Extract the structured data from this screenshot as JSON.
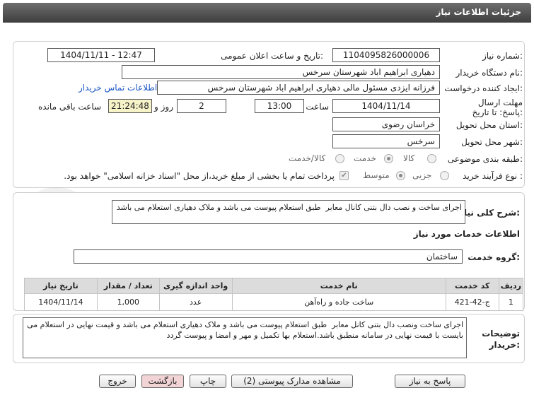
{
  "header": {
    "title": "جزئیات اطلاعات نیاز"
  },
  "need_number": {
    "label": "شماره نیاز:",
    "value": "1104095826000006"
  },
  "announce_date": {
    "label": "تاریخ و ساعت اعلان عمومی:",
    "value": "1404/11/11 - 12:47"
  },
  "buyer_org": {
    "label": "نام دستگاه خریدار:",
    "value": "دهیاری ابراهیم اباد شهرستان سرخس"
  },
  "requester": {
    "label": "ایجاد کننده درخواست:",
    "value": "فرزانه ایزدی مسئول مالی دهیاری ابراهیم اباد شهرستان سرخس",
    "contact_link": "اطلاعات تماس خریدار"
  },
  "deadline": {
    "label": "مهلت ارسال پاسخ: تا تاریخ:",
    "date": "1404/11/14",
    "time_label": "ساعت",
    "time": "13:00",
    "days": "2",
    "days_label": "روز و",
    "remaining": "21:24:48",
    "remaining_label": "ساعت باقی مانده"
  },
  "province": {
    "label": "استان محل تحویل:",
    "value": "خراسان رضوی"
  },
  "city": {
    "label": "شهر محل تحویل:",
    "value": "سرخس"
  },
  "category": {
    "label": "طبقه بندی موضوعی:",
    "options": [
      "کالا",
      "خدمت",
      "کالا/خدمت"
    ],
    "selected": "خدمت"
  },
  "process": {
    "label": "نوع فرآیند خرید :",
    "options": [
      "جزیی",
      "متوسط"
    ],
    "selected": "متوسط",
    "note": "پرداخت تمام یا بخشی از مبلغ خرید،از محل \"اسناد خزانه اسلامی\" خواهد بود."
  },
  "description": {
    "label": "شرح کلی نیاز:",
    "value": "اجرای ساخت و نصب دال بتنی کانال معابر  طبق استعلام پیوست می باشد و ملاک دهیاری استعلام می باشد"
  },
  "services_info": {
    "title": "اطلاعات خدمات مورد نیاز"
  },
  "service_group": {
    "label": "گروه خدمت:",
    "value": "ساختمان"
  },
  "table": {
    "headers": [
      "ردیف",
      "کد خدمت",
      "نام خدمت",
      "واحد اندازه گیری",
      "تعداد / مقدار",
      "تاریخ نیاز"
    ],
    "rows": [
      [
        "1",
        "ج-42-421",
        "ساخت جاده و راه‌آهن",
        "عدد",
        "1,000",
        "1404/11/14"
      ]
    ]
  },
  "buyer_notes": {
    "label": "توضیحات خریدار:",
    "value": "اجرای ساخت ونصب دال بتنی کانل معابر  طبق استعلام پیوست می باشد و ملاک دهیاری استعلام می باشد و قیمت نهایی در استعلام می بایست با قیمت نهایی در سامانه منطبق باشد.استعلام بها تکمیل و مهر و امضا و پیوست گردد"
  },
  "buttons": {
    "reply": "پاسخ به نیاز",
    "view_docs": "مشاهده مدارک پیوستی (2)",
    "print": "چاپ",
    "back": "بازگشت",
    "exit": "خروج"
  },
  "watermark": {
    "text": "AriaTender.net"
  },
  "colors": {
    "header_bg": "#4a4a4a",
    "link": "#1a57c6",
    "remaining_bg": "#f7f3c8",
    "back_btn": "#f3d4d6"
  }
}
